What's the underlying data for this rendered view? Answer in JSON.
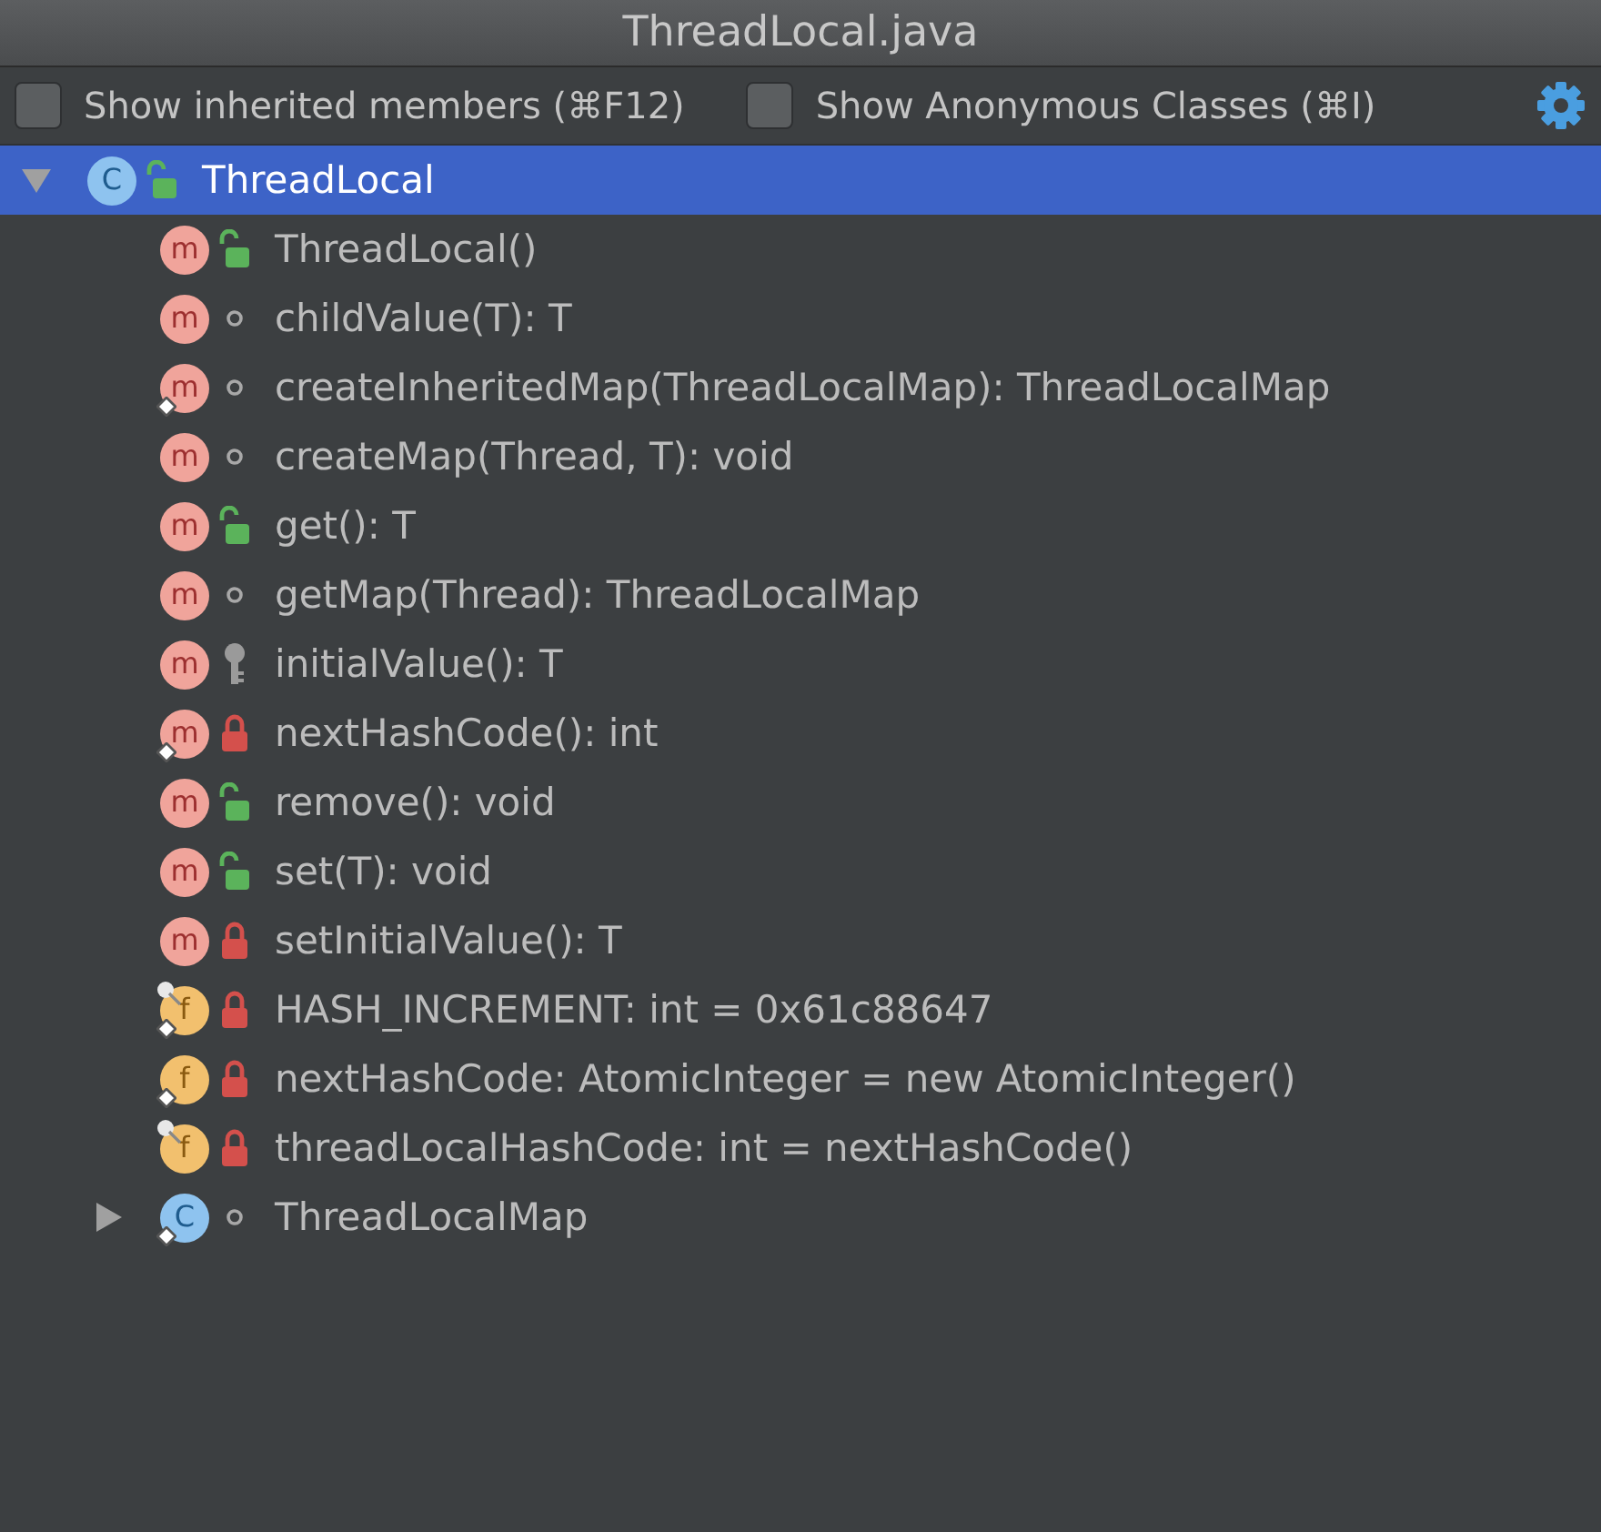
{
  "window": {
    "title": "ThreadLocal.java"
  },
  "options": [
    {
      "label": "Show inherited members (⌘F12)",
      "checked": false
    },
    {
      "label": "Show Anonymous Classes (⌘I)",
      "checked": false
    }
  ],
  "tree": [
    {
      "kind": "class",
      "badge": "C",
      "access": {
        "kind": "public"
      },
      "static": false,
      "final": false,
      "label": "ThreadLocal",
      "expanded": true,
      "selected": true,
      "children": [
        {
          "kind": "method",
          "badge": "m",
          "access": {
            "kind": "public"
          },
          "static": false,
          "final": false,
          "label": "ThreadLocal()",
          "selected": false
        },
        {
          "kind": "method",
          "badge": "m",
          "access": {
            "kind": "package"
          },
          "static": false,
          "final": false,
          "label": "childValue(T): T",
          "selected": false
        },
        {
          "kind": "method",
          "badge": "m",
          "access": {
            "kind": "package"
          },
          "static": true,
          "final": false,
          "label": "createInheritedMap(ThreadLocalMap): ThreadLocalMap",
          "selected": false
        },
        {
          "kind": "method",
          "badge": "m",
          "access": {
            "kind": "package"
          },
          "static": false,
          "final": false,
          "label": "createMap(Thread, T): void",
          "selected": false
        },
        {
          "kind": "method",
          "badge": "m",
          "access": {
            "kind": "public"
          },
          "static": false,
          "final": false,
          "label": "get(): T",
          "selected": false
        },
        {
          "kind": "method",
          "badge": "m",
          "access": {
            "kind": "package"
          },
          "static": false,
          "final": false,
          "label": "getMap(Thread): ThreadLocalMap",
          "selected": false
        },
        {
          "kind": "method",
          "badge": "m",
          "access": {
            "kind": "protected"
          },
          "static": false,
          "final": false,
          "label": "initialValue(): T",
          "selected": false
        },
        {
          "kind": "method",
          "badge": "m",
          "access": {
            "kind": "private"
          },
          "static": true,
          "final": false,
          "label": "nextHashCode(): int",
          "selected": false
        },
        {
          "kind": "method",
          "badge": "m",
          "access": {
            "kind": "public"
          },
          "static": false,
          "final": false,
          "label": "remove(): void",
          "selected": false
        },
        {
          "kind": "method",
          "badge": "m",
          "access": {
            "kind": "public"
          },
          "static": false,
          "final": false,
          "label": "set(T): void",
          "selected": false
        },
        {
          "kind": "method",
          "badge": "m",
          "access": {
            "kind": "private"
          },
          "static": false,
          "final": false,
          "label": "setInitialValue(): T",
          "selected": false
        },
        {
          "kind": "field",
          "badge": "f",
          "access": {
            "kind": "private"
          },
          "static": true,
          "final": true,
          "label": "HASH_INCREMENT: int = 0x61c88647",
          "selected": false
        },
        {
          "kind": "field",
          "badge": "f",
          "access": {
            "kind": "private"
          },
          "static": true,
          "final": false,
          "label": "nextHashCode: AtomicInteger = new AtomicInteger()",
          "selected": false
        },
        {
          "kind": "field",
          "badge": "f",
          "access": {
            "kind": "private"
          },
          "static": false,
          "final": true,
          "label": "threadLocalHashCode: int = nextHashCode()",
          "selected": false
        },
        {
          "kind": "class",
          "badge": "C",
          "access": {
            "kind": "package"
          },
          "static": true,
          "final": false,
          "label": "ThreadLocalMap",
          "expanded": false,
          "selected": false
        }
      ]
    }
  ]
}
